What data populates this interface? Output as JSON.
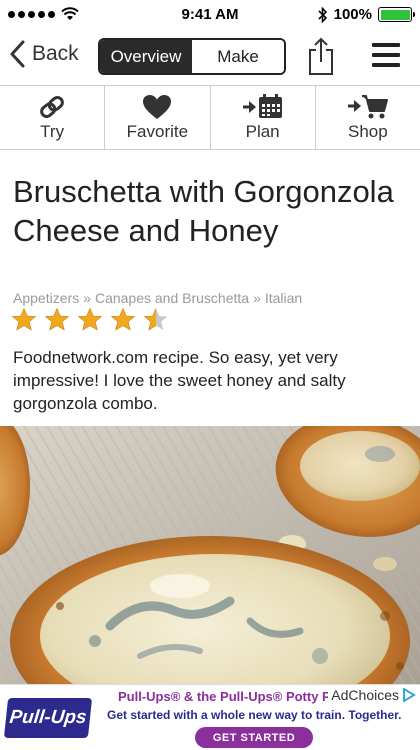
{
  "status_bar": {
    "time": "9:41 AM",
    "battery_percent": "100%",
    "battery_level": 1.0
  },
  "nav": {
    "back_label": "Back",
    "segments": [
      {
        "label": "Overview",
        "active": true
      },
      {
        "label": "Make",
        "active": false
      }
    ]
  },
  "toolbar": {
    "items": [
      {
        "label": "Try",
        "icon": "paperclip-icon"
      },
      {
        "label": "Favorite",
        "icon": "heart-icon"
      },
      {
        "label": "Plan",
        "icon": "calendar-arrow-icon"
      },
      {
        "label": "Shop",
        "icon": "cart-arrow-icon"
      }
    ]
  },
  "recipe": {
    "title": "Bruschetta with Gorgonzola Cheese and Honey",
    "breadcrumb": [
      "Appetizers",
      "Canapes and Bruschetta",
      "Italian"
    ],
    "breadcrumb_separator": "»",
    "rating": 4.5,
    "rating_max": 5,
    "description": "Foodnetwork.com recipe. So easy, yet very impressive! I love the sweet honey and salty gorgonzola combo."
  },
  "ad": {
    "logo_text": "Pull-Ups",
    "headline": "Pull-Ups® & the Pull-Ups® Potty P",
    "subline": "Get started with a whole new way to train. Together.",
    "cta": "GET STARTED",
    "adchoices": "AdChoices"
  },
  "colors": {
    "star": "#f2a81d",
    "ad_purple": "#8a2f9c",
    "ad_blue": "#2c2a8c",
    "battery_green": "#2ec43a"
  }
}
